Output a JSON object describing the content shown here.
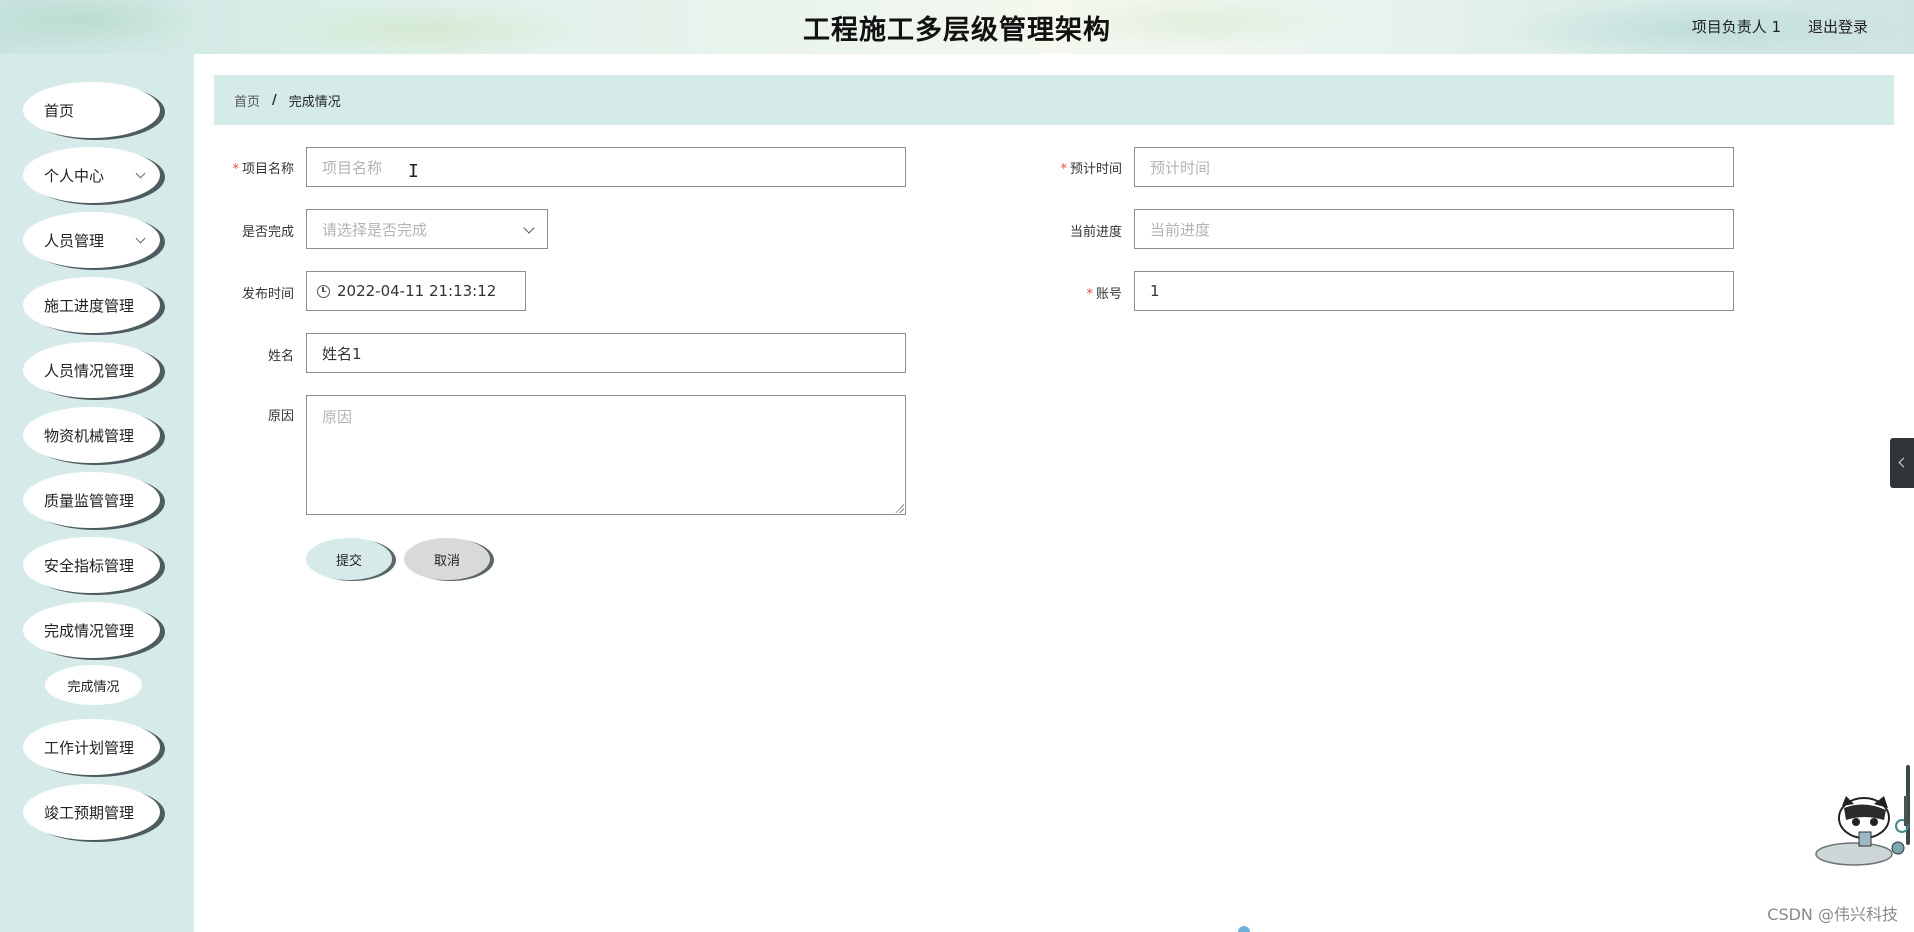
{
  "header": {
    "title": "工程施工多层级管理架构",
    "user": "项目负责人 1",
    "logout": "退出登录"
  },
  "sidebar": {
    "items": [
      {
        "label": "首页",
        "has_children": false
      },
      {
        "label": "个人中心",
        "has_children": true
      },
      {
        "label": "人员管理",
        "has_children": true
      },
      {
        "label": "施工进度管理",
        "has_children": false
      },
      {
        "label": "人员情况管理",
        "has_children": false
      },
      {
        "label": "物资机械管理",
        "has_children": false
      },
      {
        "label": "质量监管管理",
        "has_children": false
      },
      {
        "label": "安全指标管理",
        "has_children": false
      },
      {
        "label": "完成情况管理",
        "has_children": false
      },
      {
        "label": "工作计划管理",
        "has_children": false
      },
      {
        "label": "竣工预期管理",
        "has_children": false
      }
    ],
    "submenu": {
      "label": "完成情况",
      "active": true
    }
  },
  "breadcrumb": {
    "home": "首页",
    "separator": "/",
    "current": "完成情况"
  },
  "form": {
    "project_name": {
      "label": "项目名称",
      "required": true,
      "value": "",
      "placeholder": "项目名称"
    },
    "estimated_time": {
      "label": "预计时间",
      "required": true,
      "value": "",
      "placeholder": "预计时间"
    },
    "is_completed": {
      "label": "是否完成",
      "required": false,
      "value": "",
      "placeholder": "请选择是否完成"
    },
    "current_progress": {
      "label": "当前进度",
      "required": false,
      "value": "",
      "placeholder": "当前进度"
    },
    "publish_time": {
      "label": "发布时间",
      "required": false,
      "value": "2022-04-11 21:13:12"
    },
    "account": {
      "label": "账号",
      "required": true,
      "value": "1"
    },
    "name": {
      "label": "姓名",
      "required": false,
      "value": "姓名1"
    },
    "reason": {
      "label": "原因",
      "required": false,
      "value": "",
      "placeholder": "原因"
    },
    "submit_label": "提交",
    "cancel_label": "取消"
  },
  "watermark": "CSDN @伟兴科技",
  "colors": {
    "sidebar_bg": "#d6ebe9",
    "menu_shadow": "#4f5c5f",
    "required_mark": "#e84a4a",
    "side_tab": "#2f3537"
  }
}
